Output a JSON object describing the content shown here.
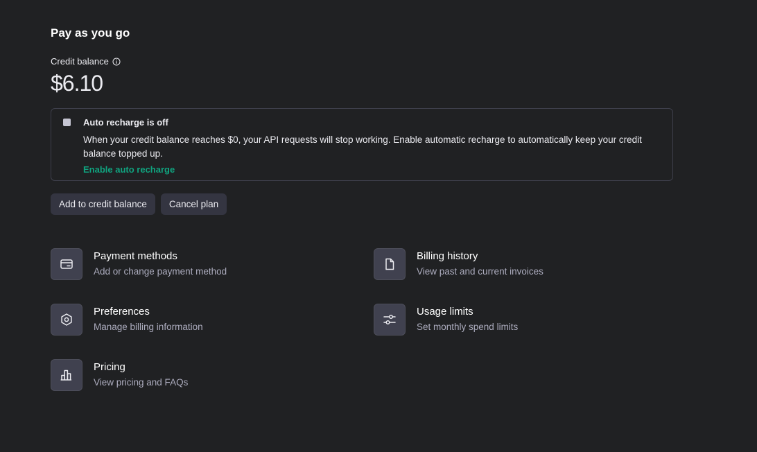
{
  "plan": {
    "title": "Pay as you go"
  },
  "balance": {
    "label": "Credit balance",
    "amount": "$6.10"
  },
  "notice": {
    "title": "Auto recharge is off",
    "text": "When your credit balance reaches $0, your API requests will stop working. Enable automatic recharge to automatically keep your credit balance topped up.",
    "link": "Enable auto recharge"
  },
  "buttons": {
    "add_credit": "Add to credit balance",
    "cancel_plan": "Cancel plan"
  },
  "links": [
    {
      "title": "Payment methods",
      "desc": "Add or change payment method",
      "icon": "credit-card-icon"
    },
    {
      "title": "Billing history",
      "desc": "View past and current invoices",
      "icon": "document-icon"
    },
    {
      "title": "Preferences",
      "desc": "Manage billing information",
      "icon": "gear-icon"
    },
    {
      "title": "Usage limits",
      "desc": "Set monthly spend limits",
      "icon": "sliders-icon"
    },
    {
      "title": "Pricing",
      "desc": "View pricing and FAQs",
      "icon": "bar-chart-icon"
    }
  ],
  "colors": {
    "background": "#202123",
    "accent": "#10a37f",
    "button_bg": "#343541",
    "icon_box_bg": "#40414f",
    "muted_text": "#acacbe"
  }
}
